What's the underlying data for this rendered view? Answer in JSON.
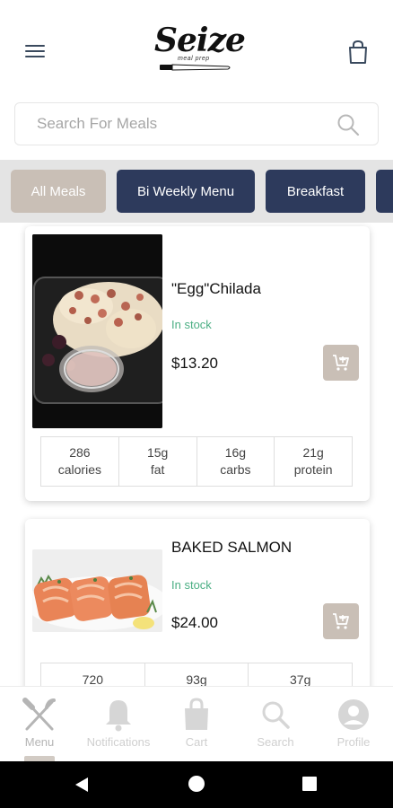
{
  "header": {
    "brand": "Seize",
    "tagline": "meal prep"
  },
  "search": {
    "placeholder": "Search For Meals"
  },
  "categories": [
    {
      "label": "All Meals",
      "active": true
    },
    {
      "label": "Bi Weekly Menu",
      "active": false
    },
    {
      "label": "Breakfast",
      "active": false
    }
  ],
  "meals": [
    {
      "name": "\"Egg\"Chilada",
      "stock": "In stock",
      "price": "$13.20",
      "nutrition": [
        {
          "value": "286",
          "unit": "calories"
        },
        {
          "value": "15g",
          "unit": "fat"
        },
        {
          "value": "16g",
          "unit": "carbs"
        },
        {
          "value": "21g",
          "unit": "protein"
        }
      ]
    },
    {
      "name": "BAKED SALMON",
      "stock": "In stock",
      "price": "$24.00",
      "nutrition": [
        {
          "value": "720"
        },
        {
          "value": "93g"
        },
        {
          "value": "37g"
        }
      ]
    }
  ],
  "bottom_nav": [
    {
      "label": "Menu",
      "icon": "fork-knife-icon",
      "active": true
    },
    {
      "label": "Notifications",
      "icon": "bell-icon",
      "active": false
    },
    {
      "label": "Cart",
      "icon": "shopping-bag-icon",
      "active": false
    },
    {
      "label": "Search",
      "icon": "search-icon",
      "active": false
    },
    {
      "label": "Profile",
      "icon": "user-circle-icon",
      "active": false
    }
  ],
  "colors": {
    "accent": "#c9bfb6",
    "category_dark": "#2d3a5c",
    "in_stock": "#4caf84",
    "header_icons": "#3a4a5e"
  }
}
